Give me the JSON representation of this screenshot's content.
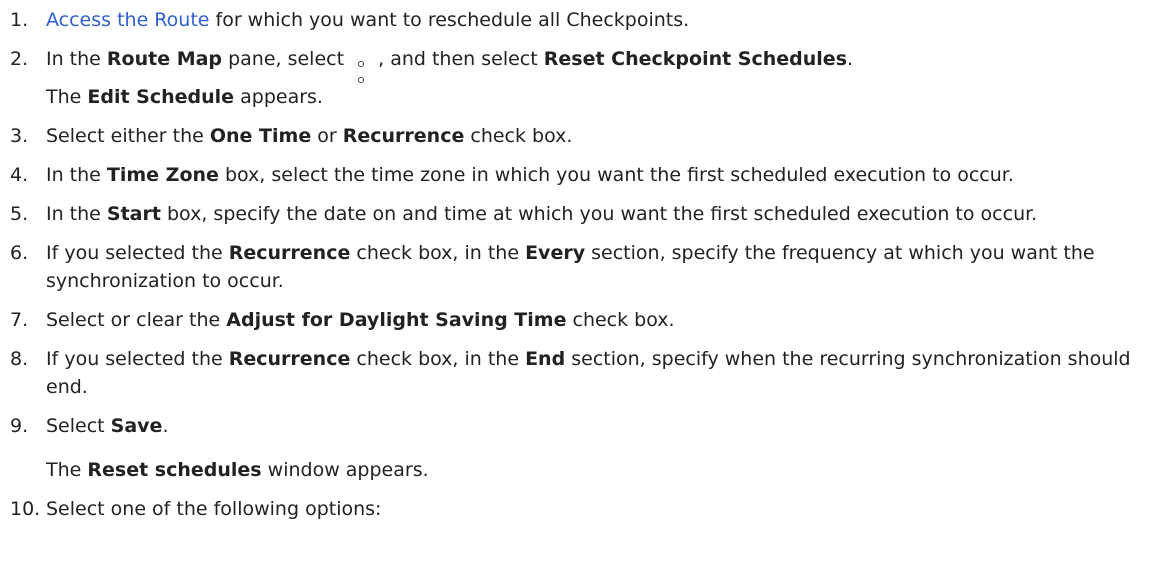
{
  "steps": [
    {
      "num": "1.",
      "link": "Access the Route",
      "rest": " for which you want to reschedule all Checkpoints."
    },
    {
      "num": "2.",
      "a": "In the ",
      "b1": "Route Map",
      "c": " pane, select ",
      "d": " , and then select ",
      "b2": "Reset Checkpoint Schedules",
      "e": ".",
      "line2_b": "The ",
      "line2_bold": "Edit Schedule",
      "line2_end": " appears."
    },
    {
      "num": "3.",
      "a": "Select either the ",
      "b1": "One Time",
      "c": " or ",
      "b2": "Recurrence",
      "d": " check box."
    },
    {
      "num": "4.",
      "a": "In the ",
      "b1": "Time Zone",
      "c": " box, select the time zone in which you want the first scheduled execution to occur."
    },
    {
      "num": "5.",
      "a": "In the ",
      "b1": "Start",
      "c": " box, specify the date on and time at which you want the first scheduled execution to occur."
    },
    {
      "num": "6.",
      "a": "If you selected the ",
      "b1": "Recurrence",
      "c": " check box, in the ",
      "b2": "Every",
      "d": " section, specify the frequency at which you want the synchronization to occur."
    },
    {
      "num": "7.",
      "a": "Select or clear the ",
      "b1": "Adjust for Daylight Saving Time",
      "c": " check box."
    },
    {
      "num": "8.",
      "a": "If you selected the ",
      "b1": "Recurrence",
      "c": " check box, in the ",
      "b2": "End",
      "d": " section, specify when the recurring synchronization should end."
    },
    {
      "num": "9.",
      "a": "Select ",
      "b1": "Save",
      "c": ".",
      "sub_a": "The ",
      "sub_b": "Reset schedules",
      "sub_c": " window appears."
    },
    {
      "num": "10.",
      "a": "Select one of the following options:"
    }
  ],
  "icons": {
    "more": "more-vertical-icon"
  },
  "colors": {
    "link": "#2f5fd1",
    "text": "#222222"
  }
}
